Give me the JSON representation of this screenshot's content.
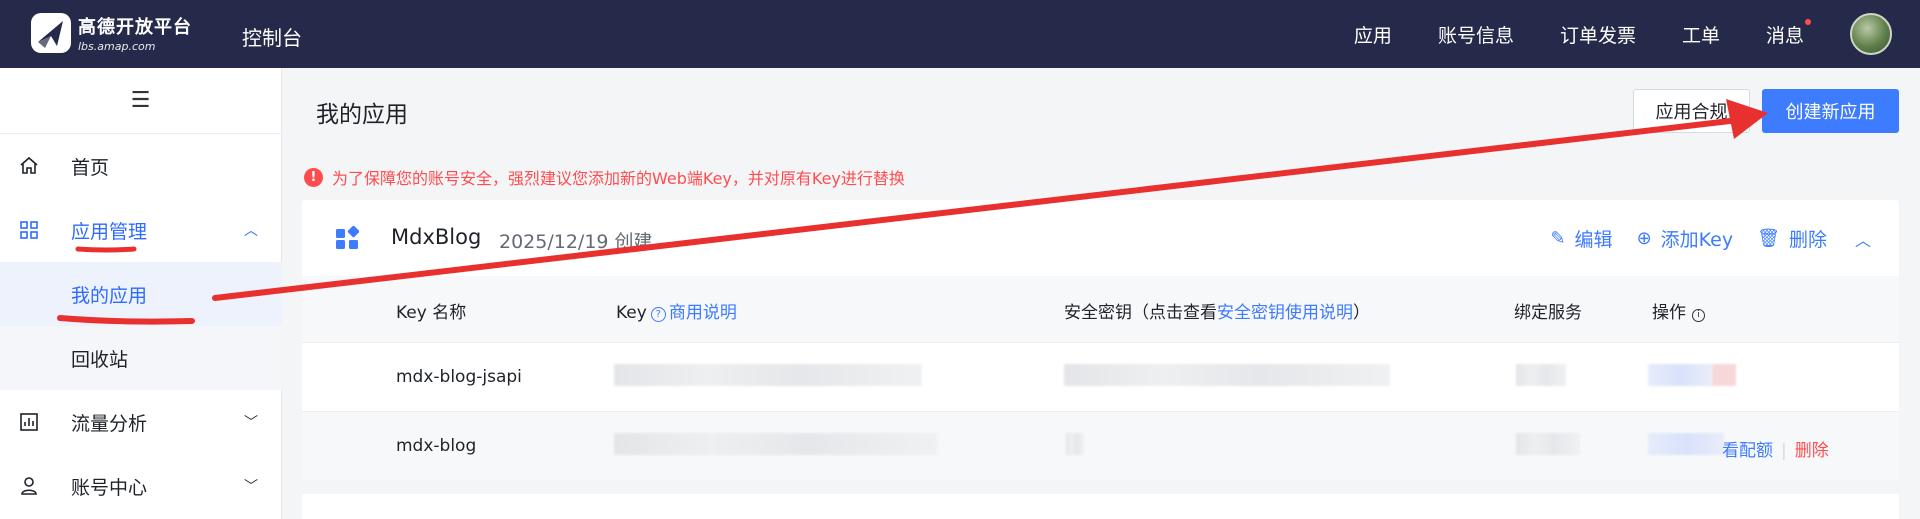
{
  "header": {
    "brand_title": "高德开放平台",
    "brand_sub": "lbs.amap.com",
    "console_title": "控制台",
    "nav": [
      "应用",
      "账号信息",
      "订单发票",
      "工单",
      "消息"
    ]
  },
  "sidebar": {
    "items": {
      "home": "首页",
      "app_mgmt": "应用管理",
      "my_apps": "我的应用",
      "recycle": "回收站",
      "traffic": "流量分析",
      "account": "账号中心"
    }
  },
  "main": {
    "title": "我的应用",
    "compliance_button": "应用合规",
    "create_button": "创建新应用",
    "warning_icon": "!",
    "warning": "为了保障您的账号安全，强烈建议您添加新的Web端Key，并对原有Key进行替换"
  },
  "app_card": {
    "name": "MdxBlog",
    "created": "2025/12/19 创建",
    "actions": {
      "edit": "编辑",
      "add_key": "添加Key",
      "delete": "删除"
    },
    "columns": {
      "key_name": "Key 名称",
      "key": "Key",
      "key_help": "商用说明",
      "secret_prefix": "安全密钥（点击查看",
      "secret_link": "安全密钥使用说明",
      "secret_suffix": "）",
      "service": "绑定服务",
      "ops": "操作"
    },
    "rows": [
      {
        "name": "mdx-blog-jsapi"
      },
      {
        "name": "mdx-blog",
        "op_quota": "看配额",
        "op_delete": "删除"
      }
    ]
  }
}
